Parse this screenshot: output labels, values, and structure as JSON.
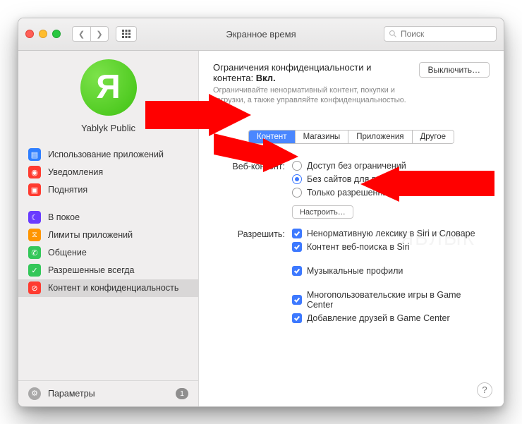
{
  "window_title": "Экранное время",
  "search_placeholder": "Поиск",
  "user_name": "Yablyk Public",
  "avatar_letter": "Я",
  "sidebar": {
    "groups": [
      [
        {
          "label": "Использование приложений",
          "icon_bg": "#2f7fff",
          "icon": "▤"
        },
        {
          "label": "Уведомления",
          "icon_bg": "#ff3b30",
          "icon": "◉"
        },
        {
          "label": "Поднятия",
          "icon_bg": "#ff3b30",
          "icon": "▣"
        }
      ],
      [
        {
          "label": "В покое",
          "icon_bg": "#6a3cff",
          "icon": "☾"
        },
        {
          "label": "Лимиты приложений",
          "icon_bg": "#ff9500",
          "icon": "⧖"
        },
        {
          "label": "Общение",
          "icon_bg": "#34c759",
          "icon": "✆"
        },
        {
          "label": "Разрешенные всегда",
          "icon_bg": "#34c759",
          "icon": "✓"
        },
        {
          "label": "Контент и конфиденциальность",
          "icon_bg": "#ff3b30",
          "icon": "⊘"
        }
      ]
    ],
    "selected": "Контент и конфиденциальность",
    "footer": {
      "label": "Параметры",
      "badge": "1"
    }
  },
  "main": {
    "title_prefix": "Ограничения конфиденциальности и контента: ",
    "title_state": "Вкл.",
    "desc": "Ограничивайте ненормативный контент, покупки и загрузки, а также управляйте конфиденциальностью.",
    "off_button": "Выключить…",
    "tabs": [
      "Контент",
      "Магазины",
      "Приложения",
      "Другое"
    ],
    "active_tab": 0,
    "web_label": "Веб-контент:",
    "web_options": [
      "Доступ без ограничений",
      "Без сайтов для взрослых",
      "Только разрешенные веб-сайты"
    ],
    "web_selected": 1,
    "configure_button": "Настроить…",
    "allow_label": "Разрешить:",
    "allow_options": [
      "Ненормативную лексику в Siri и Словаре",
      "Контент веб-поиска в Siri",
      "Музыкальные профили",
      "Многопользовательские игры в Game Center",
      "Добавление друзей в Game Center"
    ]
  },
  "watermark": "ЯБЛЫК"
}
